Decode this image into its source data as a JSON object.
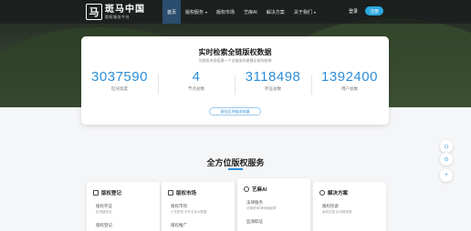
{
  "brand": {
    "name": "斑马中国",
    "tagline": "版权服务平台",
    "mark": "马"
  },
  "nav": {
    "items": [
      {
        "label": "首页",
        "active": true,
        "dropdown": false
      },
      {
        "label": "版权服务",
        "active": false,
        "dropdown": true
      },
      {
        "label": "版权市场",
        "active": false,
        "dropdown": false
      },
      {
        "label": "艺麻AI",
        "active": false,
        "dropdown": false
      },
      {
        "label": "解决方案",
        "active": false,
        "dropdown": false
      },
      {
        "label": "关于我们",
        "active": false,
        "dropdown": true
      }
    ],
    "login": "登录",
    "register": "注册"
  },
  "stats": {
    "title": "实时检索全链版权数据",
    "subtitle": "为版权市场搭建一个全链条的便捷交易的纽带",
    "items": [
      {
        "value": "3037590",
        "label": "区块高度"
      },
      {
        "value": "4",
        "label": "节点总数"
      },
      {
        "value": "3118498",
        "label": "存证总数"
      },
      {
        "value": "1392400",
        "label": "用户总数"
      }
    ],
    "link": "前往区块链浏览器"
  },
  "services": {
    "title": "全方位版权服务",
    "cards": [
      {
        "icon": "edit-icon",
        "title": "版权登记",
        "line1": "版权存证",
        "line2": "区块链存证",
        "line3": "版权登记"
      },
      {
        "icon": "grid-icon",
        "title": "版权市场",
        "line1": "版权市场",
        "line2": "小艺剧场  中外文化大数据",
        "line3": "版权推广"
      },
      {
        "icon": "ai-icon",
        "title": "艺麻AI",
        "line1": "法律服务",
        "line2": "法律咨询  律师函起草",
        "line3": "监测取证"
      },
      {
        "icon": "solution-icon",
        "title": "解决方案",
        "line1": "版权检索",
        "line2": "版权交易  区块链溯源",
        "line3": ""
      }
    ]
  },
  "floats": {
    "top": "⟨⟩",
    "mid": "⊙",
    "bottom": "+"
  },
  "colors": {
    "accent": "#2c8ed8",
    "register": "#2ba8e0",
    "nav_active": "#2b4d6e"
  }
}
